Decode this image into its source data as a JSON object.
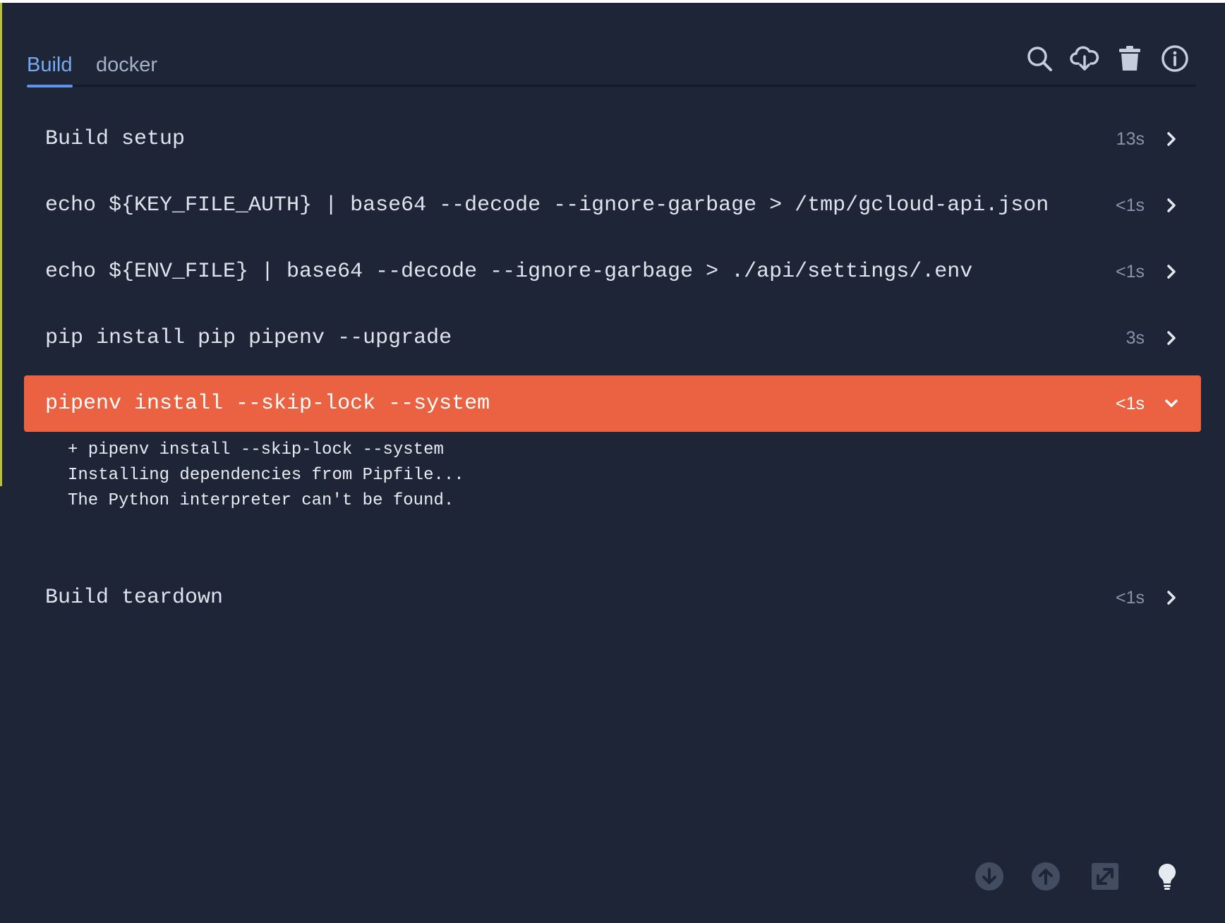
{
  "tabs": [
    {
      "label": "Build",
      "active": true
    },
    {
      "label": "docker",
      "active": false
    }
  ],
  "toolbar": {
    "icons": [
      "search-icon",
      "cloud-download-icon",
      "trash-icon",
      "info-icon"
    ]
  },
  "steps": [
    {
      "command": "Build setup",
      "duration": "13s",
      "expanded": false
    },
    {
      "command": "echo ${KEY_FILE_AUTH} | base64 --decode --ignore-garbage > /tmp/gcloud-api.json",
      "duration": "<1s",
      "expanded": false
    },
    {
      "command": "echo ${ENV_FILE} | base64 --decode --ignore-garbage > ./api/settings/.env",
      "duration": "<1s",
      "expanded": false
    },
    {
      "command": "pip install pip pipenv --upgrade",
      "duration": "3s",
      "expanded": false
    },
    {
      "command": "pipenv install --skip-lock --system",
      "duration": "<1s",
      "expanded": true,
      "status": "failed"
    },
    {
      "command": "Build teardown",
      "duration": "<1s",
      "expanded": false
    }
  ],
  "log": [
    "+ pipenv install --skip-lock --system",
    "Installing dependencies from Pipfile...",
    "The Python interpreter can't be found."
  ],
  "footer": {
    "icons": [
      "scroll-down-icon",
      "scroll-up-icon",
      "expand-icon",
      "lightbulb-icon"
    ]
  },
  "colors": {
    "background": "#1e2537",
    "failed_step": "#ea6241",
    "active_tab": "#78aaf2",
    "muted_text": "#8894a8"
  }
}
